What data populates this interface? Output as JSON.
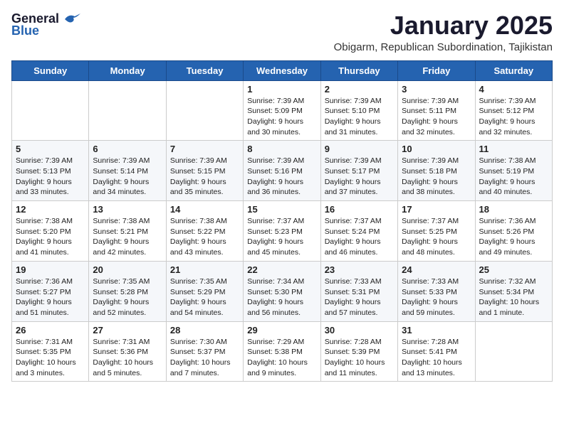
{
  "logo": {
    "general": "General",
    "blue": "Blue"
  },
  "title": "January 2025",
  "subtitle": "Obigarm, Republican Subordination, Tajikistan",
  "headers": [
    "Sunday",
    "Monday",
    "Tuesday",
    "Wednesday",
    "Thursday",
    "Friday",
    "Saturday"
  ],
  "weeks": [
    [
      {
        "day": "",
        "content": ""
      },
      {
        "day": "",
        "content": ""
      },
      {
        "day": "",
        "content": ""
      },
      {
        "day": "1",
        "content": "Sunrise: 7:39 AM\nSunset: 5:09 PM\nDaylight: 9 hours\nand 30 minutes."
      },
      {
        "day": "2",
        "content": "Sunrise: 7:39 AM\nSunset: 5:10 PM\nDaylight: 9 hours\nand 31 minutes."
      },
      {
        "day": "3",
        "content": "Sunrise: 7:39 AM\nSunset: 5:11 PM\nDaylight: 9 hours\nand 32 minutes."
      },
      {
        "day": "4",
        "content": "Sunrise: 7:39 AM\nSunset: 5:12 PM\nDaylight: 9 hours\nand 32 minutes."
      }
    ],
    [
      {
        "day": "5",
        "content": "Sunrise: 7:39 AM\nSunset: 5:13 PM\nDaylight: 9 hours\nand 33 minutes."
      },
      {
        "day": "6",
        "content": "Sunrise: 7:39 AM\nSunset: 5:14 PM\nDaylight: 9 hours\nand 34 minutes."
      },
      {
        "day": "7",
        "content": "Sunrise: 7:39 AM\nSunset: 5:15 PM\nDaylight: 9 hours\nand 35 minutes."
      },
      {
        "day": "8",
        "content": "Sunrise: 7:39 AM\nSunset: 5:16 PM\nDaylight: 9 hours\nand 36 minutes."
      },
      {
        "day": "9",
        "content": "Sunrise: 7:39 AM\nSunset: 5:17 PM\nDaylight: 9 hours\nand 37 minutes."
      },
      {
        "day": "10",
        "content": "Sunrise: 7:39 AM\nSunset: 5:18 PM\nDaylight: 9 hours\nand 38 minutes."
      },
      {
        "day": "11",
        "content": "Sunrise: 7:38 AM\nSunset: 5:19 PM\nDaylight: 9 hours\nand 40 minutes."
      }
    ],
    [
      {
        "day": "12",
        "content": "Sunrise: 7:38 AM\nSunset: 5:20 PM\nDaylight: 9 hours\nand 41 minutes."
      },
      {
        "day": "13",
        "content": "Sunrise: 7:38 AM\nSunset: 5:21 PM\nDaylight: 9 hours\nand 42 minutes."
      },
      {
        "day": "14",
        "content": "Sunrise: 7:38 AM\nSunset: 5:22 PM\nDaylight: 9 hours\nand 43 minutes."
      },
      {
        "day": "15",
        "content": "Sunrise: 7:37 AM\nSunset: 5:23 PM\nDaylight: 9 hours\nand 45 minutes."
      },
      {
        "day": "16",
        "content": "Sunrise: 7:37 AM\nSunset: 5:24 PM\nDaylight: 9 hours\nand 46 minutes."
      },
      {
        "day": "17",
        "content": "Sunrise: 7:37 AM\nSunset: 5:25 PM\nDaylight: 9 hours\nand 48 minutes."
      },
      {
        "day": "18",
        "content": "Sunrise: 7:36 AM\nSunset: 5:26 PM\nDaylight: 9 hours\nand 49 minutes."
      }
    ],
    [
      {
        "day": "19",
        "content": "Sunrise: 7:36 AM\nSunset: 5:27 PM\nDaylight: 9 hours\nand 51 minutes."
      },
      {
        "day": "20",
        "content": "Sunrise: 7:35 AM\nSunset: 5:28 PM\nDaylight: 9 hours\nand 52 minutes."
      },
      {
        "day": "21",
        "content": "Sunrise: 7:35 AM\nSunset: 5:29 PM\nDaylight: 9 hours\nand 54 minutes."
      },
      {
        "day": "22",
        "content": "Sunrise: 7:34 AM\nSunset: 5:30 PM\nDaylight: 9 hours\nand 56 minutes."
      },
      {
        "day": "23",
        "content": "Sunrise: 7:33 AM\nSunset: 5:31 PM\nDaylight: 9 hours\nand 57 minutes."
      },
      {
        "day": "24",
        "content": "Sunrise: 7:33 AM\nSunset: 5:33 PM\nDaylight: 9 hours\nand 59 minutes."
      },
      {
        "day": "25",
        "content": "Sunrise: 7:32 AM\nSunset: 5:34 PM\nDaylight: 10 hours\nand 1 minute."
      }
    ],
    [
      {
        "day": "26",
        "content": "Sunrise: 7:31 AM\nSunset: 5:35 PM\nDaylight: 10 hours\nand 3 minutes."
      },
      {
        "day": "27",
        "content": "Sunrise: 7:31 AM\nSunset: 5:36 PM\nDaylight: 10 hours\nand 5 minutes."
      },
      {
        "day": "28",
        "content": "Sunrise: 7:30 AM\nSunset: 5:37 PM\nDaylight: 10 hours\nand 7 minutes."
      },
      {
        "day": "29",
        "content": "Sunrise: 7:29 AM\nSunset: 5:38 PM\nDaylight: 10 hours\nand 9 minutes."
      },
      {
        "day": "30",
        "content": "Sunrise: 7:28 AM\nSunset: 5:39 PM\nDaylight: 10 hours\nand 11 minutes."
      },
      {
        "day": "31",
        "content": "Sunrise: 7:28 AM\nSunset: 5:41 PM\nDaylight: 10 hours\nand 13 minutes."
      },
      {
        "day": "",
        "content": ""
      }
    ]
  ]
}
